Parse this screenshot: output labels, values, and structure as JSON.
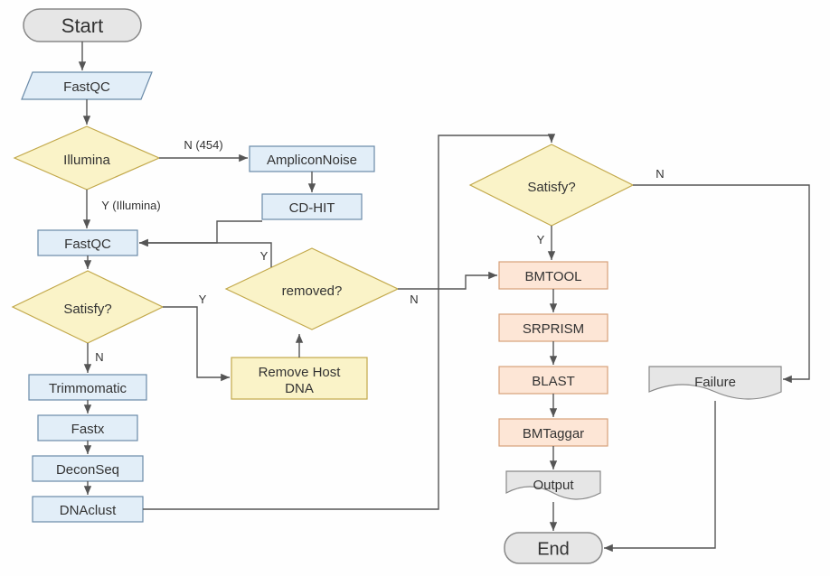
{
  "chart_data": {
    "type": "flowchart",
    "nodes": [
      {
        "id": "start",
        "shape": "terminator",
        "label": "Start"
      },
      {
        "id": "fastqc1",
        "shape": "io-parallelogram",
        "label": "FastQC"
      },
      {
        "id": "illumina",
        "shape": "decision",
        "label": "Illumina"
      },
      {
        "id": "ampliconnoise",
        "shape": "process-blue",
        "label": "AmpliconNoise"
      },
      {
        "id": "cdhit",
        "shape": "process-blue",
        "label": "CD-HIT"
      },
      {
        "id": "fastqc2",
        "shape": "process-blue",
        "label": "FastQC"
      },
      {
        "id": "satisfy1",
        "shape": "decision",
        "label": "Satisfy?"
      },
      {
        "id": "trimmomatic",
        "shape": "process-blue",
        "label": "Trimmomatic"
      },
      {
        "id": "fastx",
        "shape": "process-blue",
        "label": "Fastx"
      },
      {
        "id": "deconseq",
        "shape": "process-blue",
        "label": "DeconSeq"
      },
      {
        "id": "dnaclust",
        "shape": "process-blue",
        "label": "DNAclust"
      },
      {
        "id": "removehost",
        "shape": "process-yellow",
        "label": "Remove Host DNA"
      },
      {
        "id": "removed",
        "shape": "decision",
        "label": "removed?"
      },
      {
        "id": "satisfy2",
        "shape": "decision",
        "label": "Satisfy?"
      },
      {
        "id": "bmtool",
        "shape": "process-peach",
        "label": "BMTOOL"
      },
      {
        "id": "srprism",
        "shape": "process-peach",
        "label": "SRPRISM"
      },
      {
        "id": "blast",
        "shape": "process-peach",
        "label": "BLAST"
      },
      {
        "id": "bmtaggar",
        "shape": "process-peach",
        "label": "BMTaggar"
      },
      {
        "id": "output",
        "shape": "document",
        "label": "Output"
      },
      {
        "id": "failure",
        "shape": "document",
        "label": "Failure"
      },
      {
        "id": "end",
        "shape": "terminator",
        "label": "End"
      }
    ],
    "edges": [
      {
        "from": "start",
        "to": "fastqc1"
      },
      {
        "from": "fastqc1",
        "to": "illumina"
      },
      {
        "from": "illumina",
        "to": "fastqc2",
        "label": "Y (Illumina)"
      },
      {
        "from": "illumina",
        "to": "ampliconnoise",
        "label": "N (454)"
      },
      {
        "from": "ampliconnoise",
        "to": "cdhit"
      },
      {
        "from": "cdhit",
        "to": "fastqc2"
      },
      {
        "from": "fastqc2",
        "to": "satisfy1"
      },
      {
        "from": "satisfy1",
        "to": "trimmomatic",
        "label": "N"
      },
      {
        "from": "trimmomatic",
        "to": "fastx"
      },
      {
        "from": "fastx",
        "to": "deconseq"
      },
      {
        "from": "deconseq",
        "to": "dnaclust"
      },
      {
        "from": "dnaclust",
        "to": "satisfy2"
      },
      {
        "from": "satisfy1",
        "to": "removehost",
        "label": "Y"
      },
      {
        "from": "removehost",
        "to": "removed"
      },
      {
        "from": "removed",
        "to": "fastqc2",
        "label": "Y"
      },
      {
        "from": "removed",
        "to": "bmtool",
        "label": "N"
      },
      {
        "from": "satisfy2",
        "to": "bmtool",
        "label": "Y"
      },
      {
        "from": "satisfy2",
        "to": "failure",
        "label": "N"
      },
      {
        "from": "bmtool",
        "to": "srprism"
      },
      {
        "from": "srprism",
        "to": "blast"
      },
      {
        "from": "blast",
        "to": "bmtaggar"
      },
      {
        "from": "bmtaggar",
        "to": "output"
      },
      {
        "from": "output",
        "to": "end"
      },
      {
        "from": "failure",
        "to": "end"
      }
    ]
  },
  "labels": {
    "start": "Start",
    "fastqc1": "FastQC",
    "illumina": "Illumina",
    "ampliconnoise": "AmpliconNoise",
    "cdhit": "CD-HIT",
    "fastqc2": "FastQC",
    "satisfy1": "Satisfy?",
    "trimmomatic": "Trimmomatic",
    "fastx": "Fastx",
    "deconseq": "DeconSeq",
    "dnaclust": "DNAclust",
    "removehost_l1": "Remove Host",
    "removehost_l2": "DNA",
    "removed": "removed?",
    "satisfy2": "Satisfy?",
    "bmtool": "BMTOOL",
    "srprism": "SRPRISM",
    "blast": "BLAST",
    "bmtaggar": "BMTaggar",
    "output": "Output",
    "failure": "Failure",
    "end": "End",
    "edge_y_illumina": "Y (Illumina)",
    "edge_n_454": "N (454)",
    "edge_n": "N",
    "edge_y": "Y"
  }
}
